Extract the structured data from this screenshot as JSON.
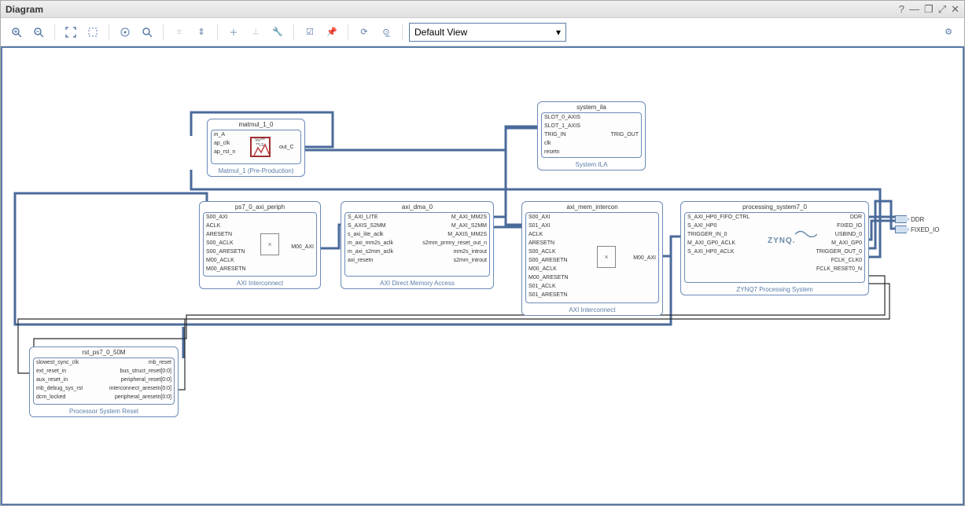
{
  "window": {
    "title": "Diagram"
  },
  "toolbar": {
    "view_select": "Default View"
  },
  "external_ports": {
    "ddr": "DDR",
    "fixed_io": "FIXED_IO"
  },
  "blocks": {
    "matmul": {
      "name": "matmul_1_0",
      "subtitle": "Matmul_1 (Pre-Production)",
      "ports_l": [
        "in_A",
        "ap_clk",
        "ap_rst_n"
      ],
      "ports_r": [
        "out_C"
      ]
    },
    "ila": {
      "name": "system_ila",
      "subtitle": "System ILA",
      "ports_l": [
        "SLOT_0_AXIS",
        "SLOT_1_AXIS",
        "TRIG_IN",
        "clk",
        "resetn"
      ],
      "ports_r": [
        "TRIG_OUT"
      ]
    },
    "periph": {
      "name": "ps7_0_axi_periph",
      "subtitle": "AXI Interconnect",
      "ports_l": [
        "S00_AXI",
        "ACLK",
        "ARESETN",
        "S00_ACLK",
        "S00_ARESETN",
        "M00_ACLK",
        "M00_ARESETN"
      ],
      "ports_r": [
        "M00_AXI"
      ]
    },
    "dma": {
      "name": "axi_dma_0",
      "subtitle": "AXI Direct Memory Access",
      "ports_l": [
        "S_AXI_LITE",
        "S_AXIS_S2MM",
        "s_axi_lite_aclk",
        "m_axi_mm2s_aclk",
        "m_axi_s2mm_aclk",
        "axi_resetn"
      ],
      "ports_r": [
        "M_AXI_MM2S",
        "M_AXI_S2MM",
        "M_AXIS_MM2S",
        "s2mm_prmry_reset_out_n",
        "mm2s_introut",
        "s2mm_introut"
      ]
    },
    "mem_intercon": {
      "name": "axi_mem_intercon",
      "subtitle": "AXI Interconnect",
      "ports_l": [
        "S00_AXI",
        "S01_AXI",
        "ACLK",
        "ARESETN",
        "S00_ACLK",
        "S00_ARESETN",
        "M00_ACLK",
        "M00_ARESETN",
        "S01_ACLK",
        "S01_ARESETN"
      ],
      "ports_r": [
        "M00_AXI"
      ]
    },
    "ps7": {
      "name": "processing_system7_0",
      "subtitle": "ZYNQ7 Processing System",
      "brand": "ZYNQ.",
      "ports_l": [
        "S_AXI_HP0_FIFO_CTRL",
        "S_AXI_HP0",
        "TRIGGER_IN_0",
        "M_AXI_GP0_ACLK",
        "S_AXI_HP0_ACLK"
      ],
      "ports_r": [
        "DDR",
        "FIXED_IO",
        "USBIND_0",
        "M_AXI_GP0",
        "TRIGGER_OUT_0",
        "FCLK_CLK0",
        "FCLK_RESET0_N"
      ]
    },
    "rst": {
      "name": "rst_ps7_0_50M",
      "subtitle": "Processor System Reset",
      "ports_l": [
        "slowest_sync_clk",
        "ext_reset_in",
        "aux_reset_in",
        "mb_debug_sys_rst",
        "dcm_locked"
      ],
      "ports_r": [
        "mb_reset",
        "bus_struct_reset[0:0]",
        "peripheral_reset[0:0]",
        "interconnect_aresetn[0:0]",
        "peripheral_aresetn[0:0]"
      ]
    }
  }
}
